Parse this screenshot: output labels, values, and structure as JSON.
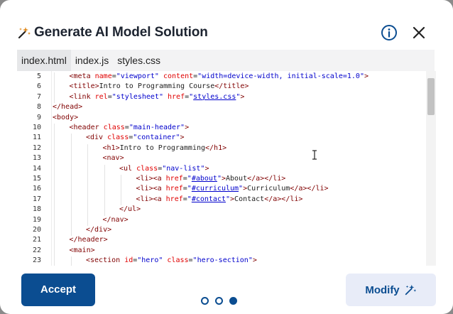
{
  "dialog": {
    "title": "Generate AI Model Solution",
    "icons": {
      "title_icon": "magic-wand-icon",
      "info": "info-icon",
      "close": "close-icon"
    }
  },
  "tabs": [
    {
      "label": "index.html",
      "active": true
    },
    {
      "label": "index.js",
      "active": false
    },
    {
      "label": "styles.css",
      "active": false
    }
  ],
  "editor": {
    "line_numbers": [
      "5",
      "6",
      "7",
      "8",
      "9",
      "10",
      "11",
      "12",
      "13",
      "14",
      "15",
      "16",
      "17",
      "18",
      "19",
      "20",
      "21",
      "22",
      "23"
    ],
    "lines": [
      "<meta name=\"viewport\" content=\"width=device-width, initial-scale=1.0\">",
      "<title>Intro to Programming Course</title>",
      "<link rel=\"stylesheet\" href=\"styles.css\">",
      "</head>",
      "<body>",
      "<header class=\"main-header\">",
      "<div class=\"container\">",
      "<h1>Intro to Programming</h1>",
      "<nav>",
      "<ul class=\"nav-list\">",
      "<li><a href=\"#about\">About</a></li>",
      "<li><a href=\"#curriculum\">Curriculum</a></li>",
      "<li><a href=\"#contact\">Contact</a></li>",
      "</ul>",
      "</nav>",
      "</div>",
      "</header>",
      "<main>",
      "<section id=\"hero\" class=\"hero-section\">"
    ],
    "indents": [
      1,
      1,
      1,
      0,
      0,
      1,
      2,
      3,
      3,
      4,
      5,
      5,
      5,
      4,
      3,
      2,
      1,
      1,
      2
    ]
  },
  "footer": {
    "accept_label": "Accept",
    "modify_label": "Modify",
    "pagination": {
      "count": 3,
      "active": 3
    }
  },
  "colors": {
    "primary": "#0b4d91",
    "secondary_bg": "#e8ecf8",
    "tag": "#800000",
    "attr_name": "#e00000",
    "attr_value": "#0000cc"
  }
}
